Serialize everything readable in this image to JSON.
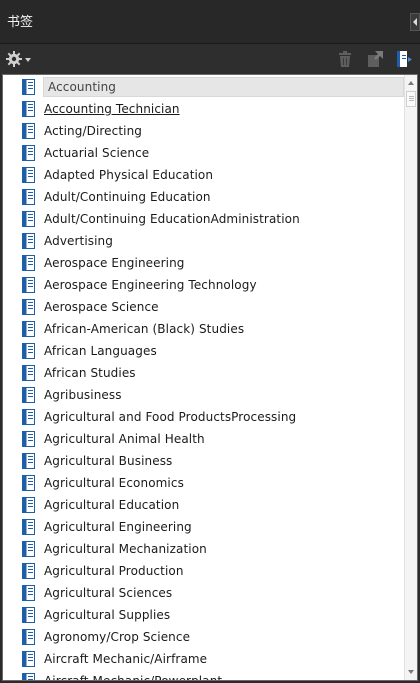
{
  "panel": {
    "title": "书签"
  },
  "toolbar": {
    "options_icon": "gear-icon",
    "delete_icon": "trash-icon",
    "expand_icon": "expand-bookmark-icon",
    "new_bookmark_icon": "new-bookmark-icon"
  },
  "bookmarks": [
    {
      "label": "Accounting",
      "state": "selected"
    },
    {
      "label": "Accounting Technician",
      "state": "hover"
    },
    {
      "label": "Acting/Directing"
    },
    {
      "label": "Actuarial Science"
    },
    {
      "label": "Adapted Physical Education"
    },
    {
      "label": "Adult/Continuing Education"
    },
    {
      "label": "Adult/Continuing EducationAdministration"
    },
    {
      "label": "Advertising"
    },
    {
      "label": "Aerospace Engineering"
    },
    {
      "label": "Aerospace Engineering Technology"
    },
    {
      "label": "Aerospace Science"
    },
    {
      "label": "African-American (Black) Studies"
    },
    {
      "label": "African Languages"
    },
    {
      "label": "African Studies"
    },
    {
      "label": "Agribusiness"
    },
    {
      "label": "Agricultural and Food ProductsProcessing"
    },
    {
      "label": "Agricultural Animal Health"
    },
    {
      "label": "Agricultural Business"
    },
    {
      "label": "Agricultural Economics"
    },
    {
      "label": "Agricultural Education"
    },
    {
      "label": "Agricultural Engineering"
    },
    {
      "label": "Agricultural Mechanization"
    },
    {
      "label": "Agricultural Production"
    },
    {
      "label": "Agricultural Sciences"
    },
    {
      "label": "Agricultural Supplies"
    },
    {
      "label": "Agronomy/Crop Science"
    },
    {
      "label": "Aircraft Mechanic/Airframe"
    },
    {
      "label": "Aircraft Mechanic/Powerplant"
    }
  ],
  "colors": {
    "panel_bg": "#2b2b2b",
    "list_bg": "#ffffff",
    "bookmark_icon": "#1f5fa8",
    "selected_bg": "#e6e6e6"
  }
}
